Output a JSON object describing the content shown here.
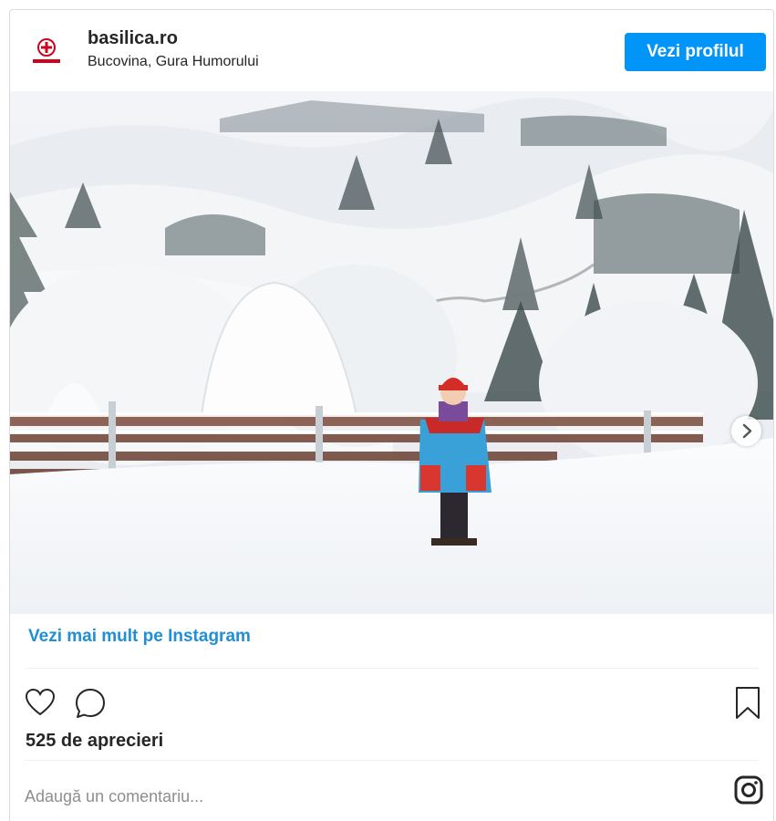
{
  "header": {
    "username": "basilica.ro",
    "location": "Bucovina, Gura Humorului",
    "view_profile_label": "Vezi profilul",
    "avatar_icon": "basilica-logo-icon"
  },
  "photo": {
    "icon_next": "chevron-right-icon"
  },
  "links": {
    "view_more": "Vezi mai mult pe Instagram"
  },
  "actions": {
    "like_icon": "heart-icon",
    "comment_icon": "comment-icon",
    "save_icon": "bookmark-icon"
  },
  "likes": {
    "text": "525 de aprecieri"
  },
  "comment": {
    "placeholder": "Adaugă un comentariu...",
    "value": ""
  },
  "footer": {
    "logo_icon": "instagram-icon"
  },
  "colors": {
    "accent": "#0095f6",
    "link": "#1f8fd6",
    "text": "#262626",
    "muted": "#8e8e8e",
    "brand_red": "#d0021b"
  }
}
